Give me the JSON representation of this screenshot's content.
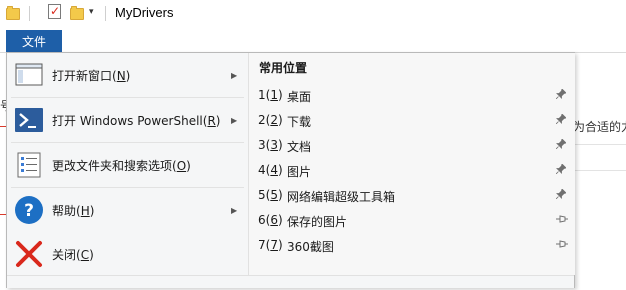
{
  "window": {
    "title": "MyDrivers"
  },
  "quick_access": {
    "icons": [
      "folder-icon",
      "properties-check-icon",
      "new-folder-icon",
      "customize-dropdown-icon"
    ],
    "dropdown_glyph": "▾"
  },
  "file_tab": {
    "label": "文件",
    "accent": "#1e5fa8"
  },
  "background": {
    "left_fragment": "号",
    "right_fragment": "为合适的力"
  },
  "menu": {
    "items": [
      {
        "label_prefix": "打开新窗口(",
        "accel": "N",
        "label_suffix": ")",
        "icon": "new-window-icon",
        "has_submenu": true
      },
      {
        "label_prefix": "打开 Windows PowerShell(",
        "accel": "R",
        "label_suffix": ")",
        "icon": "powershell-icon",
        "has_submenu": true
      },
      {
        "label_prefix": "更改文件夹和搜索选项(",
        "accel": "O",
        "label_suffix": ")",
        "icon": "folder-options-icon",
        "has_submenu": false
      },
      {
        "label_prefix": "帮助(",
        "accel": "H",
        "label_suffix": ")",
        "icon": "help-icon",
        "has_submenu": true
      },
      {
        "label_prefix": "关闭(",
        "accel": "C",
        "label_suffix": ")",
        "icon": "close-icon",
        "has_submenu": false
      }
    ],
    "submenu_arrow": "▶"
  },
  "recent": {
    "heading": "常用位置",
    "items": [
      {
        "num": "1",
        "accel": "1",
        "name": "桌面",
        "pin": "📌"
      },
      {
        "num": "2",
        "accel": "2",
        "name": "下载",
        "pin": "📌"
      },
      {
        "num": "3",
        "accel": "3",
        "name": "文档",
        "pin": "📌"
      },
      {
        "num": "4",
        "accel": "4",
        "name": "图片",
        "pin": "📌"
      },
      {
        "num": "5",
        "accel": "5",
        "name": "网络编辑超级工具箱",
        "pin": "📌"
      },
      {
        "num": "6",
        "accel": "6",
        "name": "保存的图片",
        "pin": "⊸"
      },
      {
        "num": "7",
        "accel": "7",
        "name": "360截图",
        "pin": "⊸"
      }
    ]
  },
  "colors": {
    "accent": "#1e5fa8",
    "menu_bg": "#f5f6f7",
    "close_red": "#d9281c",
    "help_blue": "#1d6fc4"
  }
}
